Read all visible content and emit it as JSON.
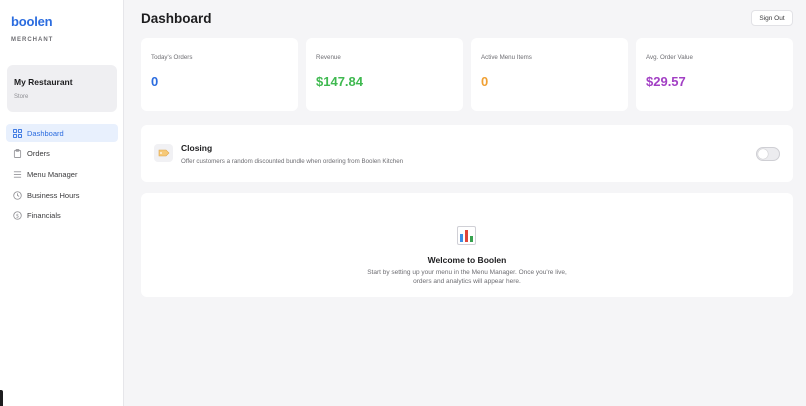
{
  "sidebar": {
    "logo": "boolen",
    "role": "MERCHANT",
    "store": {
      "name": "My Restaurant",
      "type": "Store"
    },
    "nav": [
      {
        "label": "Dashboard",
        "icon": "grid-icon",
        "active": true
      },
      {
        "label": "Orders",
        "icon": "clipboard-icon",
        "active": false
      },
      {
        "label": "Menu Manager",
        "icon": "list-icon",
        "active": false
      },
      {
        "label": "Business Hours",
        "icon": "clock-icon",
        "active": false
      },
      {
        "label": "Financials",
        "icon": "dollar-icon",
        "active": false
      }
    ]
  },
  "header": {
    "title": "Dashboard",
    "sign_out": "Sign Out"
  },
  "stats": [
    {
      "label": "Today's Orders",
      "value": "0",
      "color": "#2b6cdf"
    },
    {
      "label": "Revenue",
      "value": "$147.84",
      "color": "#3fb950"
    },
    {
      "label": "Active Menu Items",
      "value": "0",
      "color": "#f0a033"
    },
    {
      "label": "Avg. Order Value",
      "value": "$29.57",
      "color": "#a23fc4"
    }
  ],
  "closing": {
    "title": "Closing",
    "description": "Offer customers a random discounted bundle when ordering from Boolen Kitchen",
    "icon": "tag-icon",
    "enabled": false
  },
  "welcome": {
    "icon": "bar-chart-icon",
    "title": "Welcome to Boolen",
    "text": "Start by setting up your menu in the Menu Manager. Once you're live, orders and analytics will appear here."
  },
  "colors": {
    "accent": "#2b6cdf",
    "background": "#f5f5f7",
    "card": "#ffffff"
  }
}
